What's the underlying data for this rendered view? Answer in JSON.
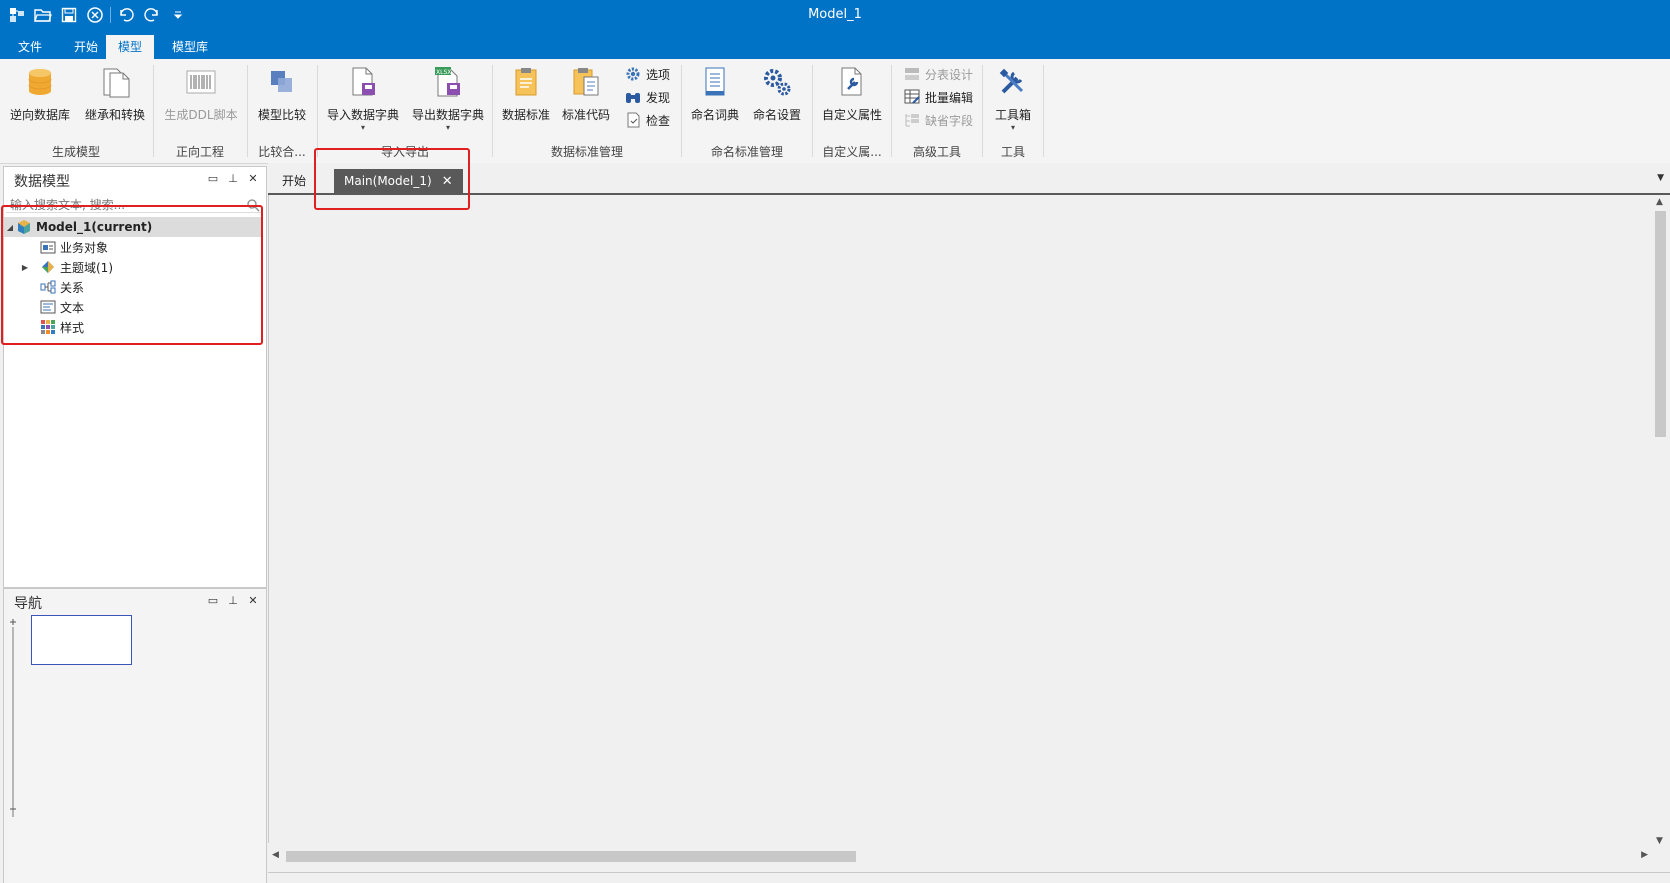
{
  "window": {
    "title": "Model_1"
  },
  "quick_access": [
    "app-icon",
    "open-folder-icon",
    "save-icon",
    "close-circle-icon",
    "undo-icon",
    "redo-icon",
    "customize-dropdown-icon"
  ],
  "menu_tabs": [
    {
      "label": "文件",
      "active": false
    },
    {
      "label": "开始",
      "active": false
    },
    {
      "label": "模型",
      "active": true
    },
    {
      "label": "模型库",
      "active": false
    }
  ],
  "ribbon": {
    "groups": {
      "gen_model": {
        "label": "生成模型",
        "reverse_db": "逆向数据库",
        "inherit": "继承和转换"
      },
      "forward": {
        "label": "正向工程",
        "gen_ddl": "生成DDL脚本"
      },
      "compare": {
        "label": "比较合...",
        "model_compare": "模型比较"
      },
      "import_export": {
        "label": "导入导出",
        "import_dict": "导入数据字典",
        "export_dict": "导出数据字典"
      },
      "standard": {
        "label": "数据标准管理",
        "data_std": "数据标准",
        "std_code": "标准代码",
        "options": "选项",
        "discover": "发现",
        "check": "检查"
      },
      "naming": {
        "label": "命名标准管理",
        "naming_dict": "命名词典",
        "naming_settings": "命名设置"
      },
      "custom": {
        "label": "自定义属...",
        "custom_attr": "自定义属性"
      },
      "advanced": {
        "label": "高级工具",
        "split_design": "分表设计",
        "batch_edit": "批量编辑",
        "missing_field": "缺省字段"
      },
      "tools": {
        "label": "工具",
        "toolbox": "工具箱"
      }
    }
  },
  "data_model_panel": {
    "title": "数据模型",
    "search_placeholder": "输入搜索文本, 搜索...",
    "tree": [
      {
        "label": "Model_1(current)",
        "icon": "model-cube-icon",
        "expanded": true,
        "selected": true
      },
      {
        "label": "业务对象",
        "icon": "business-object-icon"
      },
      {
        "label": "主题域(1)",
        "icon": "subject-area-icon",
        "collapsed": true
      },
      {
        "label": "关系",
        "icon": "relation-icon"
      },
      {
        "label": "文本",
        "icon": "text-icon"
      },
      {
        "label": "样式",
        "icon": "style-icon"
      }
    ]
  },
  "nav_panel": {
    "title": "导航"
  },
  "doc_tabs": [
    {
      "label": "开始",
      "active": false
    },
    {
      "label": "Main(Model_1)",
      "active": true,
      "close": "✕"
    }
  ],
  "colors": {
    "titlebar": "#0173c7",
    "annotation": "#e02020",
    "active_doc_tab": "#595959"
  }
}
